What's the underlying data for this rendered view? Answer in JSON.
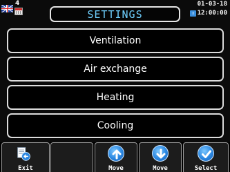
{
  "status_bar": {
    "language_flag": "uk-flag-icon",
    "user_number": "4",
    "date": "01-03-18",
    "time": "12:00:00"
  },
  "header": {
    "title": "SETTINGS"
  },
  "menu": {
    "items": [
      {
        "label": "Ventilation"
      },
      {
        "label": "Air exchange"
      },
      {
        "label": "Heating"
      },
      {
        "label": "Cooling"
      }
    ]
  },
  "softkeys": {
    "exit_label": "Exit",
    "empty_label": "",
    "move_up_label": "Move",
    "move_down_label": "Move",
    "select_label": "Select"
  },
  "colors": {
    "title_text": "#6fd0ff",
    "icon_blue": "#2a86e0",
    "background": "#0b0b0b"
  }
}
